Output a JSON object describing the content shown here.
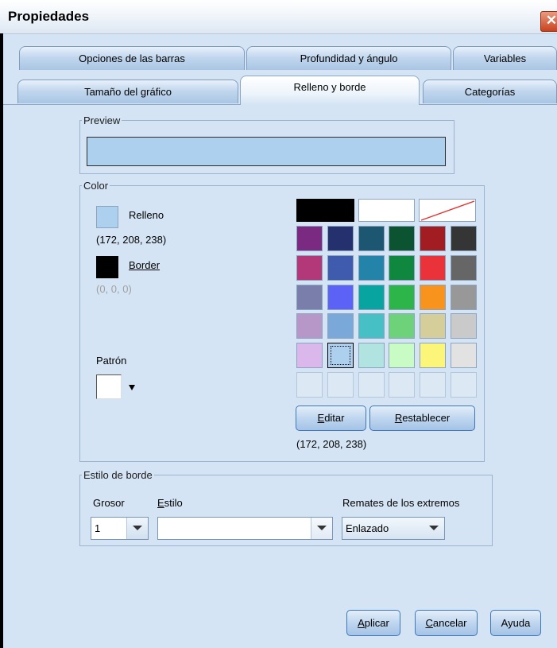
{
  "window": {
    "title": "Propiedades",
    "close_glyph": "✕"
  },
  "tabs_row1": [
    "Opciones de las barras",
    "Profundidad y ángulo",
    "Variables"
  ],
  "tabs_row2": [
    "Tamaño del gráfico",
    "Relleno y borde",
    "Categorías"
  ],
  "active_tab": "Relleno y borde",
  "preview": {
    "legend": "Preview",
    "fill_color": "#acd0ee"
  },
  "color": {
    "legend": "Color",
    "fill_label": "Relleno",
    "fill_value": "(172, 208, 238)",
    "fill_swatch": "#acd0ee",
    "border_label": "Border",
    "border_value": "(0, 0, 0)",
    "border_swatch": "#000000",
    "pattern_label": "Patrón",
    "palette_top": [
      "#000000",
      "#ffffff",
      "none"
    ],
    "palette_rows": [
      [
        "#7a2a80",
        "#25306f",
        "#1c5670",
        "#0b5331",
        "#a21d22",
        "#353535"
      ],
      [
        "#b2387a",
        "#3f5bad",
        "#2483a8",
        "#10873f",
        "#e9323a",
        "#666666"
      ],
      [
        "#7a7eaa",
        "#5b62f5",
        "#08a5a0",
        "#2eb549",
        "#f8941d",
        "#989898"
      ],
      [
        "#b797c8",
        "#7aa8d8",
        "#46c0c4",
        "#6dd27a",
        "#d5ce9a",
        "#cacaca"
      ],
      [
        "#dbb8ec",
        "#acd0ee",
        "#b1e4e0",
        "#c9fcc4",
        "#fbf67a",
        "#e2e2e2"
      ],
      [
        "",
        "",
        "",
        "",
        "",
        ""
      ]
    ],
    "selected_cell": "4-1",
    "edit_button": "Editar",
    "reset_button": "Restablecer",
    "selected_value": "(172, 208, 238)"
  },
  "border_style": {
    "legend": "Estilo de borde",
    "thickness_label": "Grosor",
    "thickness_value": "1",
    "style_label": "Estilo",
    "caps_label": "Remates de los extremos",
    "caps_value": "Enlazado"
  },
  "buttons": {
    "apply": "Aplicar",
    "cancel": "Cancelar",
    "help": "Ayuda"
  }
}
